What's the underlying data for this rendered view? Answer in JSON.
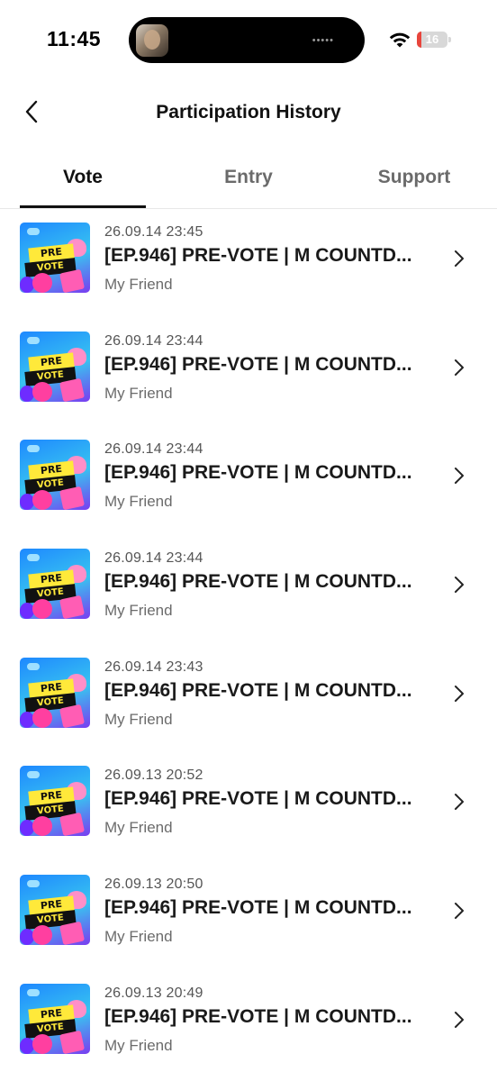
{
  "status_bar": {
    "time": "11:45",
    "battery_text": "16",
    "battery_level": 0.16,
    "battery_color": "#e8453c",
    "island_dots": "•••••",
    "icons": [
      "wifi-icon",
      "battery-icon"
    ]
  },
  "header": {
    "title": "Participation History",
    "back_icon": "chevron-left-icon"
  },
  "tabs": [
    {
      "label": "Vote",
      "active": true
    },
    {
      "label": "Entry",
      "active": false
    },
    {
      "label": "Support",
      "active": false
    }
  ],
  "thumbnail": {
    "line1": "PRE",
    "line2": "VOTE"
  },
  "items": [
    {
      "date": "26.09.14 23:45",
      "title": "[EP.946] PRE-VOTE | M COUNTD...",
      "subtitle": "My Friend"
    },
    {
      "date": "26.09.14 23:44",
      "title": "[EP.946] PRE-VOTE | M COUNTD...",
      "subtitle": "My Friend"
    },
    {
      "date": "26.09.14 23:44",
      "title": "[EP.946] PRE-VOTE | M COUNTD...",
      "subtitle": "My Friend"
    },
    {
      "date": "26.09.14 23:44",
      "title": "[EP.946] PRE-VOTE | M COUNTD...",
      "subtitle": "My Friend"
    },
    {
      "date": "26.09.14 23:43",
      "title": "[EP.946] PRE-VOTE | M COUNTD...",
      "subtitle": "My Friend"
    },
    {
      "date": "26.09.13 20:52",
      "title": "[EP.946] PRE-VOTE | M COUNTD...",
      "subtitle": "My Friend"
    },
    {
      "date": "26.09.13 20:50",
      "title": "[EP.946] PRE-VOTE | M COUNTD...",
      "subtitle": "My Friend"
    },
    {
      "date": "26.09.13 20:49",
      "title": "[EP.946] PRE-VOTE | M COUNTD...",
      "subtitle": "My Friend"
    }
  ]
}
